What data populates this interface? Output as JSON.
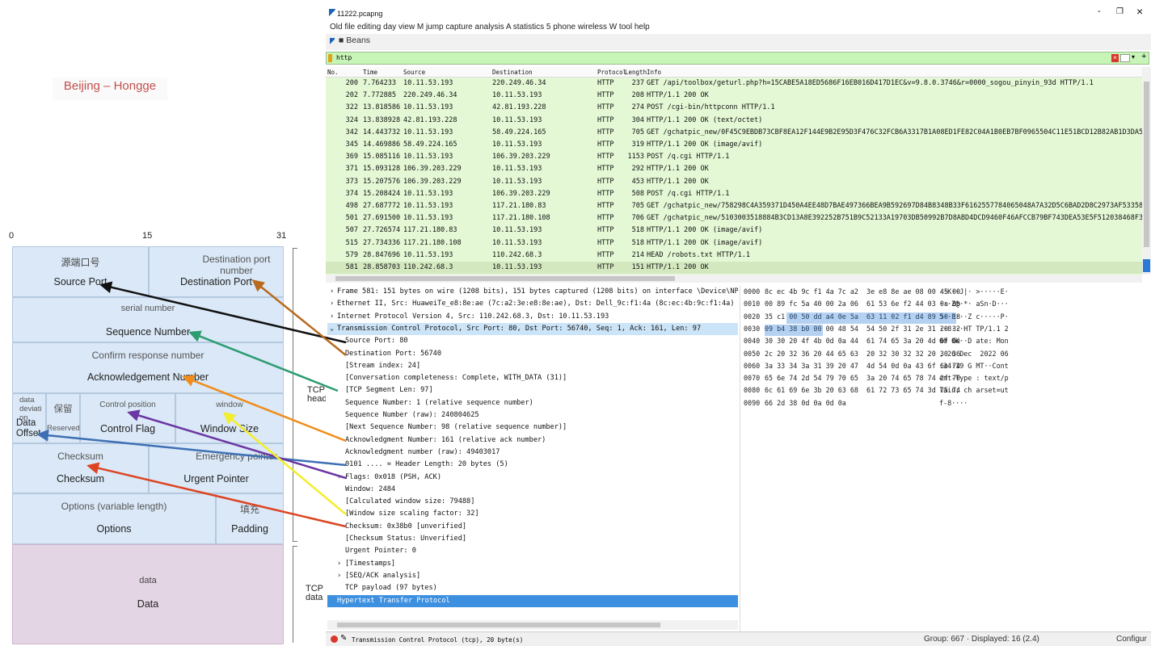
{
  "diagram": {
    "caption": "Beijing – Hongge",
    "ruler": [
      "0",
      "15",
      "31"
    ],
    "rows": {
      "src_small": "源端口号",
      "src_big": "Source Port",
      "dst_small": "Destination port number",
      "dst_big": "Destination Port",
      "seq_small": "serial number",
      "seq_big": "Sequence Number",
      "ack_small": "Confirm response number",
      "ack_big": "Acknowledgement Number",
      "data_dev_small": "data deviati on",
      "data_dev_big": "Data Offset",
      "reserved_cn": "保留",
      "reserved_en": "Reserved",
      "ctrl_small": "Control position",
      "ctrl_big": "Control Flag",
      "win_small": "window",
      "win_big": "Window Size",
      "csum_small": "Checksum",
      "csum_big": "Checksum",
      "urg_small": "Emergency pointer",
      "urg_big": "Urgent Pointer",
      "opt_small": "Options (variable length)",
      "opt_big": "Options",
      "pad_small": "填充",
      "pad_big": "Padding",
      "data_small": "data",
      "data_big": "Data"
    },
    "brace_tcp_head": "TCP head",
    "brace_tcp_data": "TCP data"
  },
  "window": {
    "title": "11222.pcapng",
    "minimize": "-",
    "restore": "❐",
    "close": "×",
    "menu": "Old file editing day view M jump capture analysis A statistics 5 phone wireless W tool help",
    "toolbar_label": "■ Beans",
    "filter": "http",
    "plus": "+"
  },
  "packet_list": {
    "headers": [
      "No.",
      "Time",
      "Source",
      "Destination",
      "Protocol",
      "Length",
      "Info"
    ],
    "rows": [
      {
        "no": "200",
        "time": "7.764233",
        "src": "10.11.53.193",
        "dst": "220.249.46.34",
        "proto": "HTTP",
        "len": "237",
        "info": "GET /api/toolbox/geturl.php?h=15CABE5A18ED5686F16EB016D417D1EC&v=9.8.0.3746&r=0000_sogou_pinyin_93d HTTP/1.1"
      },
      {
        "no": "202",
        "time": "7.772885",
        "src": "220.249.46.34",
        "dst": "10.11.53.193",
        "proto": "HTTP",
        "len": "208",
        "info": "HTTP/1.1 200 OK"
      },
      {
        "no": "322",
        "time": "13.818586",
        "src": "10.11.53.193",
        "dst": "42.81.193.228",
        "proto": "HTTP",
        "len": "274",
        "info": "POST /cgi-bin/httpconn HTTP/1.1"
      },
      {
        "no": "324",
        "time": "13.838928",
        "src": "42.81.193.228",
        "dst": "10.11.53.193",
        "proto": "HTTP",
        "len": "304",
        "info": "HTTP/1.1 200 OK  (text/octet)"
      },
      {
        "no": "342",
        "time": "14.443732",
        "src": "10.11.53.193",
        "dst": "58.49.224.165",
        "proto": "HTTP",
        "len": "705",
        "info": "GET /gchatpic_new/0F45C9EBDB73CBF8EA12F144E9B2E95D3F476C32FCB6A3317B1A08ED1FE82C04A1B0EB7BF0965504C11E51BCD12B82AB1D3DA5C54C92488D3C8AA7803DC"
      },
      {
        "no": "345",
        "time": "14.469886",
        "src": "58.49.224.165",
        "dst": "10.11.53.193",
        "proto": "HTTP",
        "len": "319",
        "info": "HTTP/1.1 200 OK  (image/avif)"
      },
      {
        "no": "369",
        "time": "15.085116",
        "src": "10.11.53.193",
        "dst": "106.39.203.229",
        "proto": "HTTP",
        "len": "1153",
        "info": "POST /q.cgi HTTP/1.1"
      },
      {
        "no": "371",
        "time": "15.093128",
        "src": "106.39.203.229",
        "dst": "10.11.53.193",
        "proto": "HTTP",
        "len": "292",
        "info": "HTTP/1.1 200 OK"
      },
      {
        "no": "373",
        "time": "15.207576",
        "src": "106.39.203.229",
        "dst": "10.11.53.193",
        "proto": "HTTP",
        "len": "453",
        "info": "HTTP/1.1 200 OK"
      },
      {
        "no": "374",
        "time": "15.208424",
        "src": "10.11.53.193",
        "dst": "106.39.203.229",
        "proto": "HTTP",
        "len": "508",
        "info": "POST /q.cgi HTTP/1.1"
      },
      {
        "no": "498",
        "time": "27.687772",
        "src": "10.11.53.193",
        "dst": "117.21.180.83",
        "proto": "HTTP",
        "len": "705",
        "info": "GET /gchatpic_new/758298C4A359371D450A4EE48D7BAE497366BEA9B592697D84B8348B33F6162557784065048A7A32D5C6BAD2D8C2973AF5335812B815067EBF8C15FCC03F6"
      },
      {
        "no": "501",
        "time": "27.691500",
        "src": "10.11.53.193",
        "dst": "117.21.180.108",
        "proto": "HTTP",
        "len": "706",
        "info": "GET /gchatpic_new/5103003518884B3CD13A8E392252B751B9C52133A19703DB50992B7D8ABD4DCD9460F46AFCCB79BF743DEA53E5F512038468F37CB06BA1E1743E6678E0D2"
      },
      {
        "no": "507",
        "time": "27.726574",
        "src": "117.21.180.83",
        "dst": "10.11.53.193",
        "proto": "HTTP",
        "len": "518",
        "info": "HTTP/1.1 200 OK  (image/avif)"
      },
      {
        "no": "515",
        "time": "27.734336",
        "src": "117.21.180.108",
        "dst": "10.11.53.193",
        "proto": "HTTP",
        "len": "518",
        "info": "HTTP/1.1 200 OK  (image/avif)"
      },
      {
        "no": "579",
        "time": "28.847696",
        "src": "10.11.53.193",
        "dst": "110.242.68.3",
        "proto": "HTTP",
        "len": "214",
        "info": "HEAD /robots.txt HTTP/1.1"
      },
      {
        "no": "581",
        "time": "28.858703",
        "src": "110.242.68.3",
        "dst": "10.11.53.193",
        "proto": "HTTP",
        "len": "151",
        "info": "HTTP/1.1 200 OK"
      }
    ]
  },
  "tree": [
    "Frame 581: 151 bytes on wire (1208 bits), 151 bytes captured (1208 bits) on interface \\Device\\NPF_{4C21A90E-F9DD-4300",
    "Ethernet II, Src: HuaweiTe_e8:8e:ae (7c:a2:3e:e8:8e:ae), Dst: Dell_9c:f1:4a (8c:ec:4b:9c:f1:4a)",
    "Internet Protocol Version 4, Src: 110.242.68.3, Dst: 10.11.53.193",
    "Transmission Control Protocol, Src Port: 80, Dst Port: 56740, Seq: 1, Ack: 161, Len: 97",
    "Source Port: 80",
    "Destination Port: 56740",
    "[Stream index: 24]",
    "[Conversation completeness: Complete, WITH_DATA (31)]",
    "[TCP Segment Len: 97]",
    "Sequence Number: 1    (relative sequence number)",
    "Sequence Number (raw): 240804625",
    "[Next Sequence Number: 98    (relative sequence number)]",
    "Acknowledgment Number: 161    (relative ack number)",
    "Acknowledgment number (raw): 49403017",
    "0101 .... = Header Length: 20 bytes (5)",
    "Flags: 0x018 (PSH, ACK)",
    "Window: 2484",
    "[Calculated window size: 79488]",
    "[Window size scaling factor: 32]",
    "Checksum: 0x38b0 [unverified]",
    "[Checksum Status: Unverified]",
    "Urgent Pointer: 0",
    "[Timestamps]",
    "[SEQ/ACK analysis]",
    "TCP payload (97 bytes)",
    "Hypertext Transfer Protocol"
  ],
  "hex": {
    "offsets": [
      "0000",
      "0010",
      "0020",
      "0030",
      "0040",
      "0050",
      "0060",
      "0070",
      "0080",
      "0090"
    ],
    "bytes": [
      "8c ec 4b 9c f1 4a 7c a2  3e e8 8e ae 08 00 45 00",
      "00 89 fc 5a 40 00 2a 06  61 53 6e f2 44 03 0a 0b",
      "35 c1 00 50 dd a4 0e 5a  63 11 02 f1 d4 89 50 18",
      "09 b4 38 b0 00 00 48 54  54 50 2f 31 2e 31 20 32",
      "30 30 20 4f 4b 0d 0a 44  61 74 65 3a 20 4d 6f 6e",
      "2c 20 32 36 20 44 65 63  20 32 30 32 32 20 30 36",
      "3a 33 34 3a 31 39 20 47  4d 54 0d 0a 43 6f 6e 74",
      "65 6e 74 2d 54 79 70 65  3a 20 74 65 78 74 2f 70",
      "6c 61 69 6e 3b 20 63 68  61 72 73 65 74 3d 75 74",
      "66 2d 38 0d 0a 0d 0a"
    ],
    "ascii": [
      "··K··J|· >·····E·",
      "···Z@·*· aSn·D···",
      "5··P···Z c·····P·",
      "··8···HT TP/1.1 2",
      "00 OK··D ate: Mon",
      ", 26 Dec  2022 06",
      ":34:19 G MT··Cont",
      "ent-Type : text/p",
      "lain; ch arset=ut",
      "f-8····"
    ]
  },
  "status": {
    "field": "Transmission Control Protocol (tcp), 20 byte(s)",
    "counts": "Group: 667 · Displayed: 16 (2.4)",
    "profile": "Configur"
  },
  "colors": {
    "list_bg": "#e4f8d5",
    "filter_bg": "#c7f5b7",
    "selection": "#2b7bd6",
    "header_cell": "#dae8f7",
    "data_cell": "#e4d5e5"
  }
}
